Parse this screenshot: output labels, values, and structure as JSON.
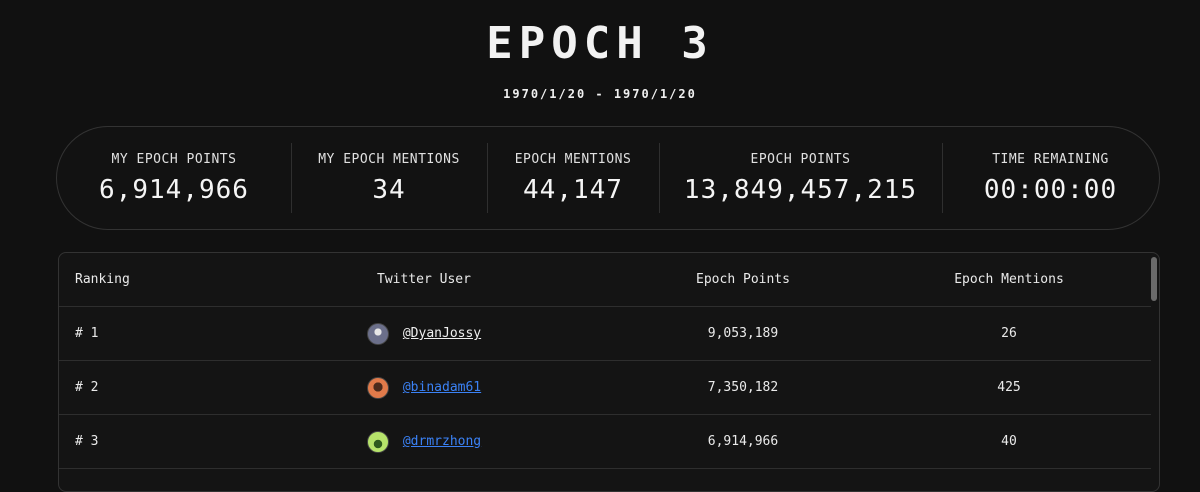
{
  "header": {
    "title": "EPOCH 3",
    "date_range": "1970/1/20 - 1970/1/20"
  },
  "stats": [
    {
      "label": "MY EPOCH POINTS",
      "value": "6,914,966"
    },
    {
      "label": "MY EPOCH MENTIONS",
      "value": "34"
    },
    {
      "label": "EPOCH MENTIONS",
      "value": "44,147"
    },
    {
      "label": "EPOCH POINTS",
      "value": "13,849,457,215"
    },
    {
      "label": "TIME REMAINING",
      "value": "00:00:00"
    }
  ],
  "table": {
    "headers": {
      "ranking": "Ranking",
      "user": "Twitter User",
      "points": "Epoch Points",
      "mentions": "Epoch Mentions"
    },
    "rows": [
      {
        "rank": "# 1",
        "handle": "@DyanJossy",
        "points": "9,053,189",
        "mentions": "26",
        "handle_color": "#f0f0f0",
        "avatar_color": "#6b6f8a",
        "avatar_icon": "portrait-avatar-1"
      },
      {
        "rank": "# 2",
        "handle": "@binadam61",
        "points": "7,350,182",
        "mentions": "425",
        "handle_color": "#3b82f6",
        "avatar_color": "#e07a4a",
        "avatar_icon": "portrait-avatar-2"
      },
      {
        "rank": "# 3",
        "handle": "@drmrzhong",
        "points": "6,914,966",
        "mentions": "40",
        "handle_color": "#3b82f6",
        "avatar_color": "#b6e36b",
        "avatar_icon": "frog-avatar"
      }
    ]
  },
  "colors": {
    "background": "#111111",
    "link_blue": "#3b82f6",
    "border": "#333333"
  }
}
